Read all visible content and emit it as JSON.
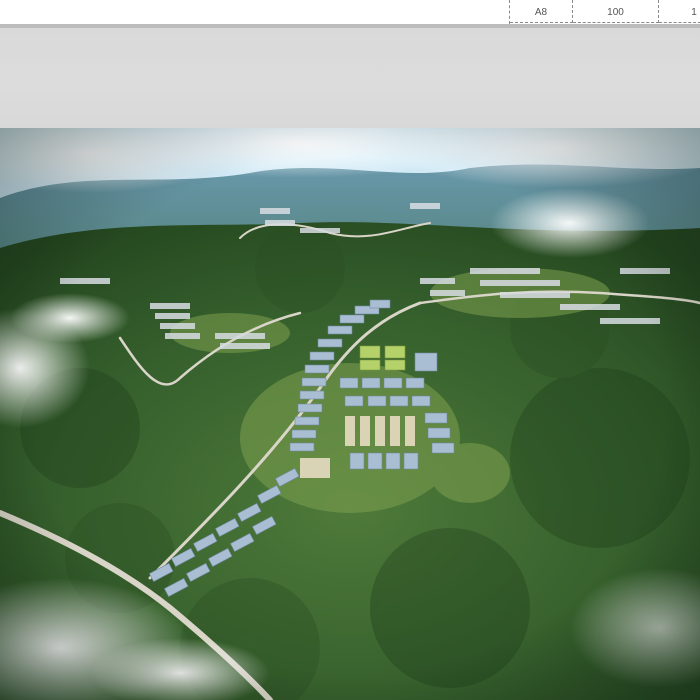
{
  "document_table": {
    "cells": [
      "A8",
      "100",
      "1"
    ]
  },
  "rendering": {
    "subject": "industrial-park-aerial-view",
    "colors": {
      "sky": "#cfe6f2",
      "forest": "#2f5a2a",
      "roofs": "#9fb3c8"
    }
  }
}
